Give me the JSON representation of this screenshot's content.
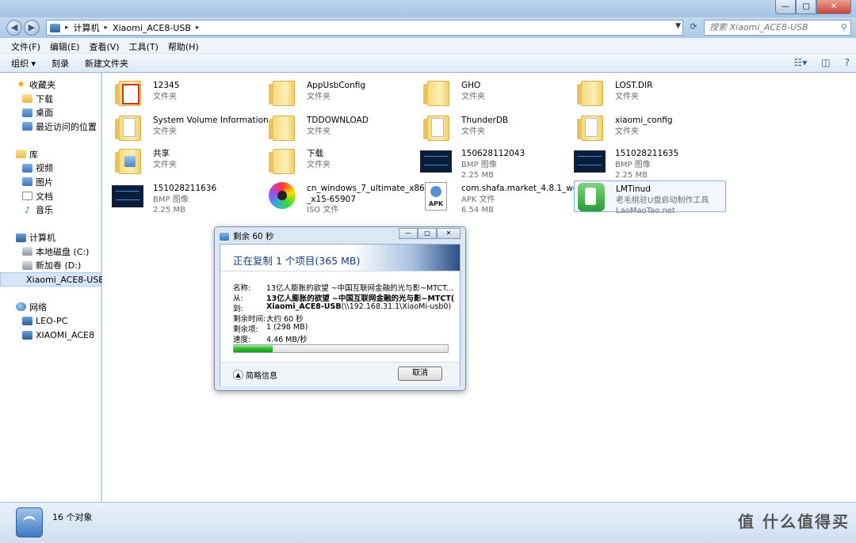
{
  "window": {
    "min": "—",
    "max": "□",
    "close": "✕"
  },
  "address": {
    "crumbs": [
      "计算机",
      "Xiaomi_ACE8-USB"
    ],
    "search_placeholder": "搜索 Xiaomi_ACE8-USB"
  },
  "menu": [
    "文件(F)",
    "编辑(E)",
    "查看(V)",
    "工具(T)",
    "帮助(H)"
  ],
  "toolbar": {
    "organize": "组织 ▾",
    "burn": "刻录",
    "new_folder": "新建文件夹"
  },
  "sidebar": [
    {
      "label": "收藏夹",
      "icon": "star",
      "kind": "top"
    },
    {
      "label": "下载",
      "icon": "folder",
      "kind": "sub"
    },
    {
      "label": "桌面",
      "icon": "blue",
      "kind": "sub"
    },
    {
      "label": "最近访问的位置",
      "icon": "blue",
      "kind": "sub"
    },
    {
      "label": "",
      "kind": "gap"
    },
    {
      "label": "库",
      "icon": "folder",
      "kind": "top"
    },
    {
      "label": "视频",
      "icon": "blue",
      "kind": "sub"
    },
    {
      "label": "图片",
      "icon": "blue",
      "kind": "sub"
    },
    {
      "label": "文档",
      "icon": "note",
      "kind": "sub"
    },
    {
      "label": "音乐",
      "icon": "music",
      "kind": "sub"
    },
    {
      "label": "",
      "kind": "gap"
    },
    {
      "label": "计算机",
      "icon": "pc",
      "kind": "top"
    },
    {
      "label": "本地磁盘 (C:)",
      "icon": "drive",
      "kind": "sub"
    },
    {
      "label": "新加卷 (D:)",
      "icon": "drive",
      "kind": "sub"
    },
    {
      "label": "Xiaomi_ACE8-USB",
      "icon": "pc",
      "kind": "sub",
      "selected": true
    },
    {
      "label": "",
      "kind": "gap"
    },
    {
      "label": "网络",
      "icon": "globe",
      "kind": "top"
    },
    {
      "label": "LEO-PC",
      "icon": "pc",
      "kind": "sub"
    },
    {
      "label": "XIAOMI_ACE8",
      "icon": "pc",
      "kind": "sub"
    }
  ],
  "files": [
    {
      "name": "12345",
      "sub": "文件夹",
      "icon": "folder-red"
    },
    {
      "name": "AppUsbConfig",
      "sub": "文件夹",
      "icon": "folder"
    },
    {
      "name": "GHO",
      "sub": "文件夹",
      "icon": "folder"
    },
    {
      "name": "LOST.DIR",
      "sub": "文件夹",
      "icon": "folder"
    },
    {
      "name": "System Volume Information",
      "sub": "文件夹",
      "icon": "folder-doc"
    },
    {
      "name": "TDDOWNLOAD",
      "sub": "文件夹",
      "icon": "folder"
    },
    {
      "name": "ThunderDB",
      "sub": "文件夹",
      "icon": "folder-doc"
    },
    {
      "name": "xiaomi_config",
      "sub": "文件夹",
      "icon": "folder-doc"
    },
    {
      "name": "共享",
      "sub": "文件夹",
      "icon": "folder-share"
    },
    {
      "name": "下载",
      "sub": "文件夹",
      "icon": "folder"
    },
    {
      "name": "150628112043",
      "sub": "BMP 图像",
      "size": "2.25 MB",
      "icon": "bmp"
    },
    {
      "name": "151028211635",
      "sub": "BMP 图像",
      "size": "2.25 MB",
      "icon": "bmp"
    },
    {
      "name": "151028211636",
      "sub": "BMP 图像",
      "size": "2.25 MB",
      "icon": "bmp"
    },
    {
      "name": "cn_windows_7_ultimate_x86_dvd",
      "name2": "_x15-65907",
      "sub": "ISO 文件",
      "icon": "iso"
    },
    {
      "name": "com.shafa.market_4.8.1_webapp",
      "sub": "APK 文件",
      "size": "6.54 MB",
      "icon": "apk"
    },
    {
      "name": "LMTinud",
      "sub": "老毛桃驻U盘启动制作工具",
      "size": "LaoMaoTao.net",
      "icon": "lmt",
      "selected": true
    }
  ],
  "status": {
    "count": "16 个对象",
    "watermark": "值 什么值得买"
  },
  "dialog": {
    "title": "剩余 60 秒",
    "heading": "正在复制 1 个项目(365 MB)",
    "rows": [
      {
        "k": "名称:",
        "v": "13亿人膨胀的欲望 ~中国互联网金融的光与影~MTCT...",
        "bold": false
      },
      {
        "k": "从:",
        "v": "13亿人膨胀的欲望 ~中国互联网金融的光与影~MTCT(",
        "bold": true
      },
      {
        "k": "到:",
        "v": "Xiaomi_ACE8-USB",
        "v2": " (\\\\192.168.31.1\\XiaoMi-usb0)",
        "bold": true
      },
      {
        "k": "剩余时间:",
        "v": "大约 60 秒",
        "bold": false
      },
      {
        "k": "剩余项:",
        "v": "1 (298 MB)",
        "bold": false
      },
      {
        "k": "速度:",
        "v": "4.46 MB/秒",
        "bold": false
      }
    ],
    "progress": 0.18,
    "more": "简略信息",
    "cancel": "取消",
    "btn_min": "—",
    "btn_max": "□",
    "btn_close": "✕"
  }
}
